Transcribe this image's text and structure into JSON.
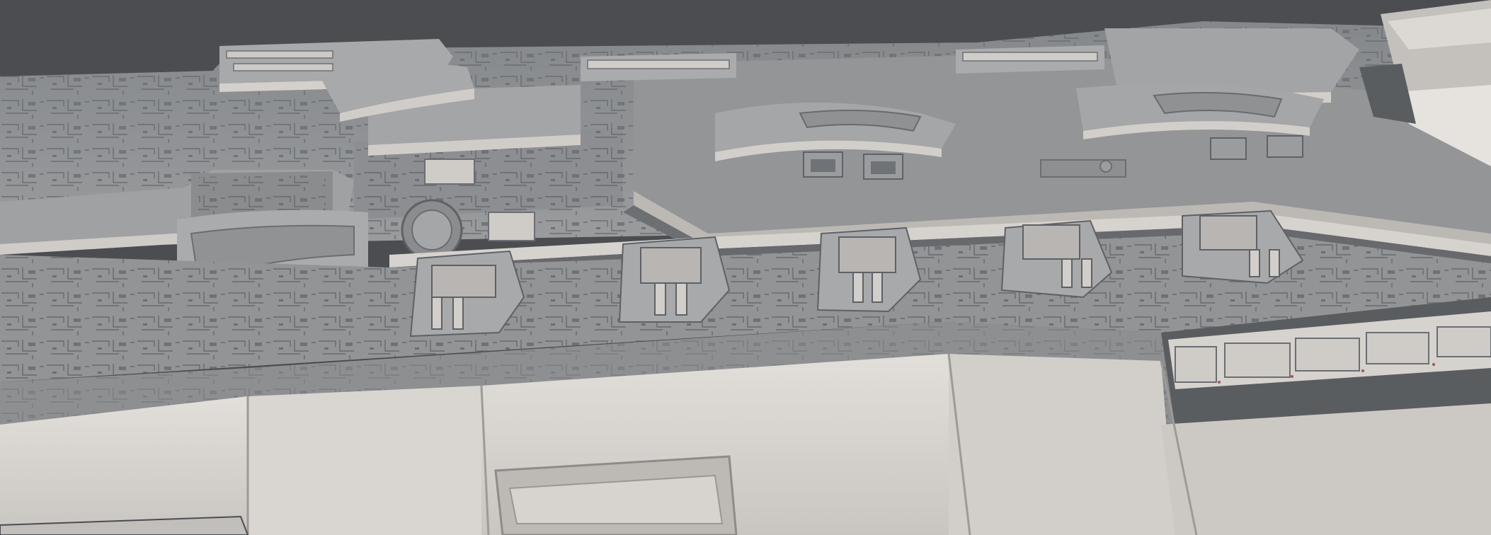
{
  "scene": {
    "subject": "spaceship-hull-render",
    "palette": {
      "background": "#4b4d50",
      "deck": "#8f9193",
      "deck_dark": "#7d7f82",
      "panel_light": "#d8d4d0",
      "panel_mid": "#bdb9b5",
      "shadow": "#45494c",
      "line": "#5d6064",
      "accent_red": "#a3535a"
    },
    "turrets": {
      "rear_count": 4,
      "front_count": 5
    }
  }
}
